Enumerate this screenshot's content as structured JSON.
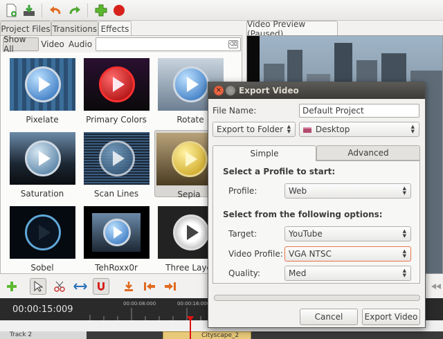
{
  "tabs": {
    "project_files": "Project Files",
    "transitions": "Transitions",
    "effects": "Effects"
  },
  "filters": {
    "show_all": "Show All",
    "video": "Video",
    "audio": "Audio",
    "search_value": ""
  },
  "effects": [
    {
      "label": "Pixelate"
    },
    {
      "label": "Primary Colors"
    },
    {
      "label": "Rotate"
    },
    {
      "label": "Saturation"
    },
    {
      "label": "Scan Lines"
    },
    {
      "label": "Sepia"
    },
    {
      "label": "Sobel"
    },
    {
      "label": "TehRoxx0r"
    },
    {
      "label": "Three Layer"
    }
  ],
  "preview": {
    "tab": "Video Preview (Paused)"
  },
  "timeline": {
    "timecode": "00:00:15:009",
    "ticks": [
      "00:00:08:000",
      "00:00:16:000"
    ],
    "track": "Track 2",
    "clip": "Cityscape_2"
  },
  "dialog": {
    "title": "Export Video",
    "file_name_label": "File Name:",
    "file_name_value": "Default Project",
    "export_to": "Export to Folder",
    "folder": "Desktop",
    "tab_simple": "Simple",
    "tab_advanced": "Advanced",
    "section1": "Select a Profile to start:",
    "profile_label": "Profile:",
    "profile_value": "Web",
    "section2": "Select from the following options:",
    "target_label": "Target:",
    "target_value": "YouTube",
    "video_profile_label": "Video Profile:",
    "video_profile_value": "VGA NTSC",
    "quality_label": "Quality:",
    "quality_value": "Med",
    "progress": 0,
    "cancel": "Cancel",
    "export": "Export Video"
  }
}
